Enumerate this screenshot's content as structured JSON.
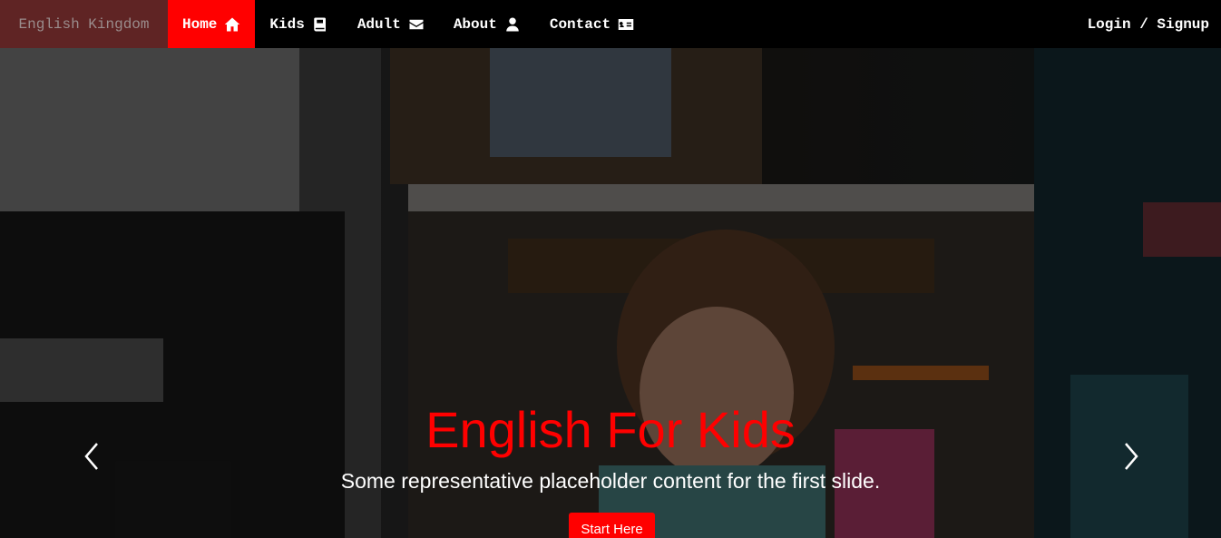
{
  "navbar": {
    "brand": "English Kingdom",
    "items": [
      {
        "label": "Home",
        "icon": "home-icon",
        "active": true
      },
      {
        "label": "Kids",
        "icon": "book-icon"
      },
      {
        "label": "Adult",
        "icon": "envelope-icon"
      },
      {
        "label": "About",
        "icon": "user-icon"
      },
      {
        "label": "Contact",
        "icon": "contact-card-icon"
      }
    ],
    "login": "Login / Signup"
  },
  "carousel": {
    "title": "English For Kids",
    "subtitle": "Some representative placeholder content for the first slide.",
    "button": "Start Here",
    "prev_icon": "chevron-left-icon",
    "next_icon": "chevron-right-icon"
  },
  "colors": {
    "accent": "#ff0000",
    "brand_bg": "#5f2424",
    "navbar_bg": "#000000"
  }
}
